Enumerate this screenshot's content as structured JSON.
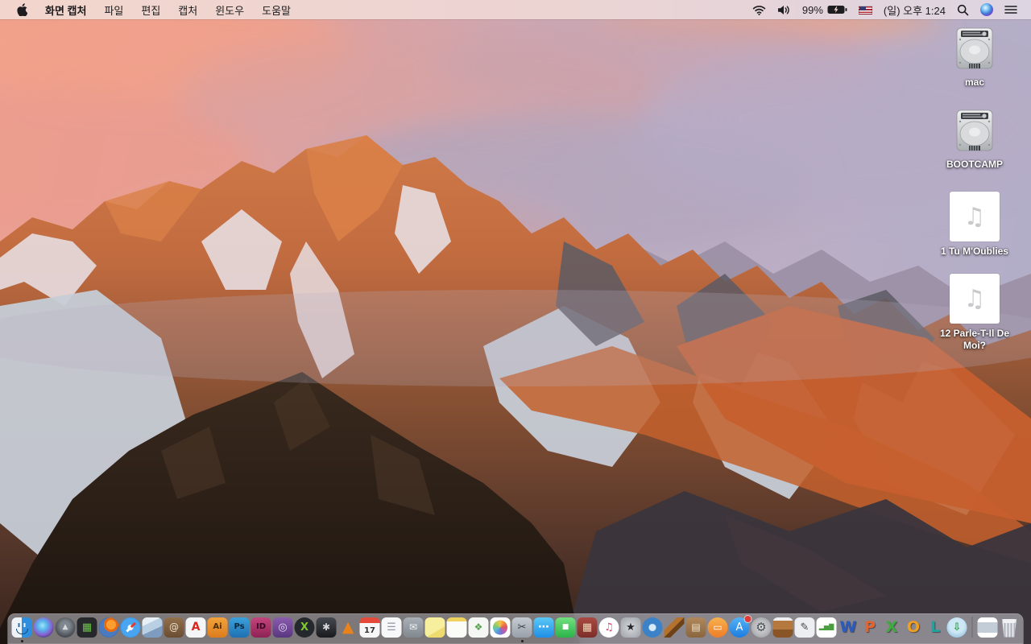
{
  "menu_bar": {
    "app_name": "화면 캡처",
    "menus": [
      "파일",
      "편집",
      "캡처",
      "윈도우",
      "도움말"
    ],
    "status": {
      "battery_percent": "99%",
      "battery_charging": true,
      "clock": "(일) 오후 1:24"
    }
  },
  "desktop": {
    "icons": [
      {
        "name": "mac",
        "label": "mac",
        "type": "hard-drive"
      },
      {
        "name": "bootcamp",
        "label": "BOOTCAMP",
        "type": "hard-drive"
      },
      {
        "name": "tu-moublies",
        "label": "1 Tu M'Oublies",
        "type": "audio-file"
      },
      {
        "name": "parle-t-il-de-moi",
        "label": "12 Parle-T-Il De Moi?",
        "type": "audio-file"
      }
    ]
  },
  "dock": {
    "items": [
      {
        "name": "finder",
        "shape": "rounded finder",
        "bg": "linear-gradient(90deg,#eef3f8 0 50%,#2e8fe0 50% 100%)",
        "glyph": "",
        "running": true
      },
      {
        "name": "siri",
        "shape": "circle",
        "bg": "radial-gradient(circle at 45% 40%,#9be8f5 0%,#58b1ec 30%,#8a5fd0 58%,#243059 88%)",
        "glyph": ""
      },
      {
        "name": "launchpad",
        "shape": "circle",
        "bg": "radial-gradient(circle at 50% 42%,#80878f 0 28%,#3e4248 78%)",
        "fg": "#d6dae0",
        "glyph": "▲",
        "size": 9
      },
      {
        "name": "mission-control",
        "shape": "rounded",
        "bg": "#26282c",
        "fg": "#6cc24a",
        "glyph": "▦",
        "size": 13
      },
      {
        "name": "firefox",
        "shape": "circle",
        "bg": "radial-gradient(circle at 62% 36%,#ff9e30 0 6px,#e66a12 6px 9px,rgba(0,0,0,0) 9px),radial-gradient(circle,#4a7bc0 0 60%,#2c508e 100%)",
        "glyph": ""
      },
      {
        "name": "safari",
        "shape": "circle safari",
        "bg": "radial-gradient(circle,#eaf6fd 0 3px,#47a5f2 4px 60%,#1e78d7 100%)",
        "glyph": ""
      },
      {
        "name": "preview",
        "shape": "rounded",
        "bg": "linear-gradient(155deg,#e8f0f7 0 30%,#b9cfe4 30% 60%,#7d9cbe 60% 100%)",
        "glyph": ""
      },
      {
        "name": "contacts",
        "shape": "rounded",
        "bg": "linear-gradient(#93704c,#6b4d31)",
        "fg": "#ece0cd",
        "glyph": "@",
        "size": 12
      },
      {
        "name": "acrobat",
        "shape": "rounded",
        "bg": "#f4f5f6",
        "fg": "#d6281e",
        "glyph": "A",
        "size": 14,
        "bold": true
      },
      {
        "name": "illustrator",
        "shape": "rounded",
        "bg": "linear-gradient(#f2a23c,#dd7d1d)",
        "fg": "#4a2d00",
        "glyph": "Ai",
        "size": 10,
        "bold": true
      },
      {
        "name": "photoshop",
        "shape": "rounded",
        "bg": "linear-gradient(#3ba1dc,#1e70b2)",
        "fg": "#08263c",
        "glyph": "Ps",
        "size": 10,
        "bold": true
      },
      {
        "name": "indesign",
        "shape": "rounded",
        "bg": "linear-gradient(#c2447c,#8f2355)",
        "fg": "#33091f",
        "glyph": "ID",
        "size": 10,
        "bold": true
      },
      {
        "name": "toast",
        "shape": "rounded",
        "bg": "linear-gradient(#8a5cae,#5a3680)",
        "fg": "#e6d8f2",
        "glyph": "◎",
        "size": 13
      },
      {
        "name": "x-image-app",
        "shape": "circle",
        "bg": "#25282c",
        "fg": "#7ec832",
        "glyph": "X",
        "size": 13,
        "bold": true
      },
      {
        "name": "disk-utility-app",
        "shape": "rounded",
        "bg": "linear-gradient(#45494f,#191a1d)",
        "fg": "#d2d6db",
        "glyph": "✱",
        "size": 12
      },
      {
        "name": "vlc",
        "shape": "plain",
        "bg": "none",
        "fg": "#e8821c",
        "glyph": "▲",
        "size": 19
      },
      {
        "name": "calendar",
        "shape": "rounded cal",
        "bg": "linear-gradient(#e5493a 0 7px,#f7f7f7 7px)",
        "fg": "#333333",
        "glyph": "17",
        "size": 10,
        "bold": true
      },
      {
        "name": "reminders",
        "shape": "rounded",
        "bg": "#f7f8fa",
        "fg": "#9097a0",
        "glyph": "☰",
        "size": 13
      },
      {
        "name": "mail-archive-app",
        "shape": "rounded",
        "bg": "linear-gradient(#aab0b8,#81878f)",
        "fg": "#f2f4f6",
        "glyph": "✉",
        "size": 12
      },
      {
        "name": "stickies",
        "shape": "rounded",
        "bg": "linear-gradient(150deg,#f7ee9e 0 65%,#eddc6d 65%)",
        "glyph": ""
      },
      {
        "name": "notes",
        "shape": "rounded",
        "bg": "linear-gradient(#efd35e 0 5px,#fbfbf8 5px)",
        "glyph": ""
      },
      {
        "name": "document-manager-app",
        "shape": "rounded",
        "bg": "#f5f7f4",
        "fg": "#58a24f",
        "glyph": "❖",
        "size": 12
      },
      {
        "name": "photos",
        "shape": "rounded",
        "bg": "radial-gradient(circle at 50% 50%,rgba(255,255,255,0) 0 9px,#ffffff 9px),conic-gradient(from 0deg,#f6c14f,#ef8b3c,#e05c5c,#c75c9e,#8a6cc9,#5c8fd6,#5cb9d9,#7ac77a,#b5d05c,#f6c14f)",
        "glyph": ""
      },
      {
        "name": "grab-screen-capture",
        "shape": "rounded",
        "bg": "linear-gradient(#c6cbd2,#98a0aa)",
        "fg": "#3a3f46",
        "glyph": "✂",
        "size": 13,
        "running": true
      },
      {
        "name": "messages",
        "shape": "rounded",
        "bg": "linear-gradient(#5ac8f5,#1f8fe8)",
        "fg": "#ffffff",
        "glyph": "⋯",
        "size": 14,
        "bold": true
      },
      {
        "name": "facetime",
        "shape": "rounded",
        "bg": "linear-gradient(#72e07e,#2cb34a)",
        "fg": "#ffffff",
        "glyph": "■",
        "size": 9
      },
      {
        "name": "photo-booth",
        "shape": "rounded",
        "bg": "linear-gradient(#a84a42,#7d2e29)",
        "fg": "#f2d8b8",
        "glyph": "▦",
        "size": 13
      },
      {
        "name": "itunes",
        "shape": "circle",
        "bg": "radial-gradient(circle,#ffffff 0 68%,#ececf2 68%)",
        "fg": "#e0457b",
        "glyph": "♫",
        "size": 13
      },
      {
        "name": "imovie",
        "shape": "rounded",
        "bg": "radial-gradient(#d6d8dc,#9da1a7)",
        "fg": "#26282c",
        "glyph": "★",
        "size": 13
      },
      {
        "name": "dvd-studio-app",
        "shape": "circle",
        "bg": "radial-gradient(circle,#d8ecf8 0 4px,#3b82c8 5px 100%)",
        "fg": "#bfe0f5",
        "glyph": ""
      },
      {
        "name": "garageband",
        "shape": "plain",
        "bg": "linear-gradient(135deg,rgba(0,0,0,0) 0 32%,#b5722f 32% 50%,#6e4218 50% 66%,rgba(0,0,0,0) 66%)",
        "glyph": ""
      },
      {
        "name": "scrapbook-kit-app",
        "shape": "rounded",
        "bg": "linear-gradient(#b0885c,#8a653e)",
        "fg": "#f0e4cf",
        "glyph": "▤",
        "size": 12
      },
      {
        "name": "ibooks",
        "shape": "circle",
        "bg": "linear-gradient(#f8b04e,#ee7d28)",
        "fg": "#ffffff",
        "glyph": "▭",
        "size": 12
      },
      {
        "name": "app-store",
        "shape": "circle",
        "bg": "linear-gradient(#53b1f5,#1d7de0)",
        "fg": "#ffffff",
        "glyph": "A",
        "size": 13,
        "badge": true
      },
      {
        "name": "system-preferences",
        "shape": "circle",
        "bg": "radial-gradient(#dcdde0,#95979c)",
        "fg": "#4c4f54",
        "glyph": "⚙",
        "size": 15
      },
      {
        "name": "keynote",
        "shape": "rounded",
        "bg": "linear-gradient(#f0f0f0 0 4px,#b5783f 4px 60%,#8a5526 60%)",
        "glyph": ""
      },
      {
        "name": "pages",
        "shape": "rounded",
        "bg": "#eceef1",
        "fg": "#44484e",
        "glyph": "✎",
        "size": 13
      },
      {
        "name": "numbers",
        "shape": "rounded",
        "bg": "#ffffff",
        "fg": "#4a9e3f",
        "glyph": "▂▅▇",
        "size": 8,
        "bold": true
      },
      {
        "name": "word",
        "shape": "plain",
        "bg": "none",
        "fg": "#2a5bc0",
        "glyph": "W",
        "size": 19,
        "bold": true,
        "shadow": true
      },
      {
        "name": "powerpoint",
        "shape": "plain",
        "bg": "none",
        "fg": "#e8622c",
        "glyph": "P",
        "size": 19,
        "bold": true,
        "shadow": true
      },
      {
        "name": "excel",
        "shape": "plain",
        "bg": "none",
        "fg": "#3faa3f",
        "glyph": "X",
        "size": 19,
        "bold": true,
        "shadow": true
      },
      {
        "name": "outlook",
        "shape": "plain",
        "bg": "none",
        "fg": "#f0a01e",
        "glyph": "O",
        "size": 19,
        "bold": true,
        "shadow": true
      },
      {
        "name": "lync",
        "shape": "plain",
        "bg": "none",
        "fg": "#18a7a0",
        "glyph": "L",
        "size": 19,
        "bold": true,
        "shadow": true
      },
      {
        "name": "download-manager-app",
        "shape": "circle",
        "bg": "radial-gradient(circle at 50% 40%,#cde7f5 0 45%,#7fb3d9 100%)",
        "fg": "#2f9e3f",
        "glyph": "⇩",
        "size": 13,
        "bold": true
      }
    ],
    "trailing": [
      {
        "name": "recent-document",
        "shape": "rounded",
        "bg": "linear-gradient(#ffffff 0 6px,#c3cdd8 6px 19px,#ffffff 19px)",
        "glyph": ""
      },
      {
        "name": "trash",
        "shape": "trash",
        "glyph": ""
      }
    ]
  }
}
